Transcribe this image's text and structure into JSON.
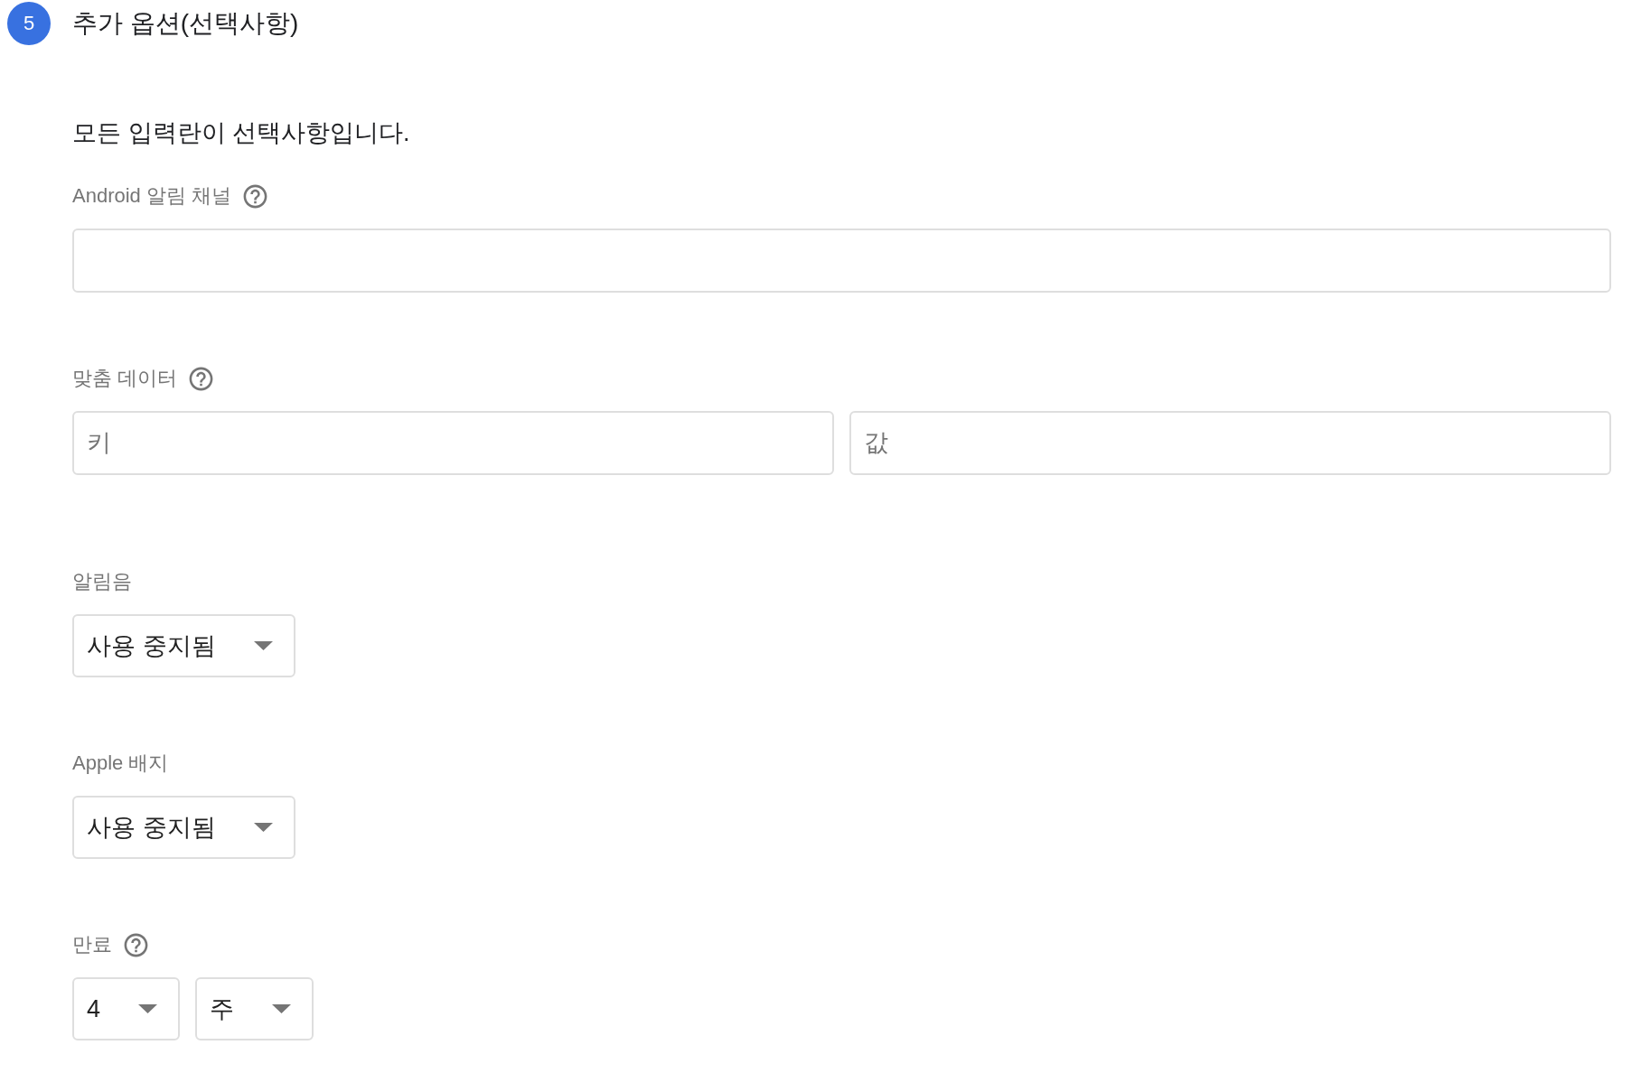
{
  "step": {
    "number": "5",
    "title": "추가 옵션(선택사항)"
  },
  "intro": "모든 입력란이 선택사항입니다.",
  "fields": [
    {
      "kind": "text",
      "label": "Android 알림 채널",
      "help": true
    },
    {
      "kind": "key_value",
      "label": "맞춤 데이터",
      "help": true,
      "inputs": [
        {
          "placeholder": "키"
        },
        {
          "placeholder": "값"
        }
      ]
    },
    {
      "kind": "select",
      "label": "알림음",
      "help": false,
      "selects": [
        {
          "value": "사용 중지됨"
        }
      ]
    },
    {
      "kind": "select",
      "label": "Apple 배지",
      "help": false,
      "selects": [
        {
          "value": "사용 중지됨"
        }
      ]
    },
    {
      "kind": "select",
      "label": "만료",
      "help": true,
      "selects": [
        {
          "value": "4"
        },
        {
          "value": "주"
        }
      ]
    }
  ]
}
